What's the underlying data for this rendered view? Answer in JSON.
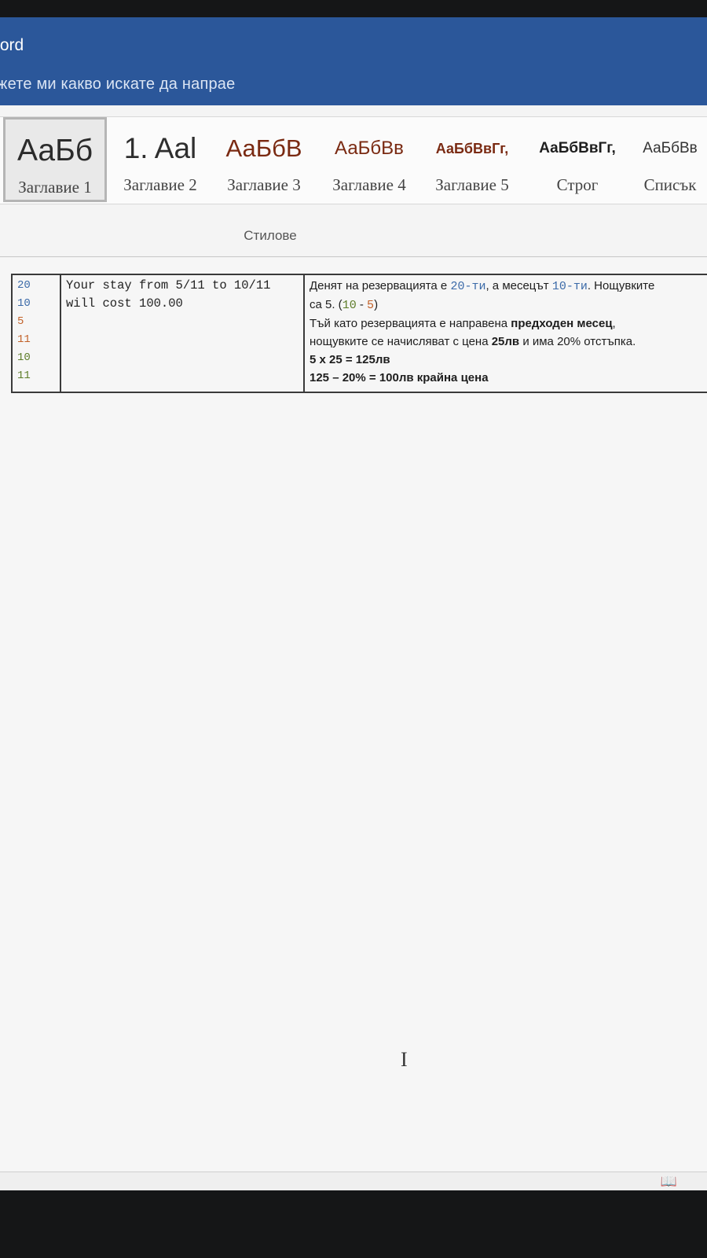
{
  "title_bar": {
    "app_name": "/ord",
    "tell_me": "жете ми какво искате да напрае"
  },
  "ribbon": {
    "styles": [
      {
        "sample": "АаБб",
        "name": "Заглавие 1",
        "selected": true
      },
      {
        "sample": "1. Aal",
        "name": "Заглавие 2"
      },
      {
        "sample": "АаБбВ",
        "name": "Заглавие 3"
      },
      {
        "sample": "АаБбВв",
        "name": "Заглавие 4"
      },
      {
        "sample": "АаБбВвГг,",
        "name": "Заглавие 5"
      },
      {
        "sample": "АаБбВвГг,",
        "name": "Строг"
      },
      {
        "sample": "АаБбВв",
        "name": "Списък"
      }
    ],
    "group_label": "Стилове"
  },
  "document": {
    "input_lines": [
      "20",
      "10",
      "5",
      "11",
      "10",
      "11"
    ],
    "output_text": "Your stay from 5/11 to 10/11 will cost 100.00",
    "note": {
      "l1_a": "Денят на резервацията е ",
      "l1_day": "20-ти",
      "l1_b": ", а месецът ",
      "l1_month": "10-ти",
      "l1_c": ". Нощувките",
      "l2_a": "са 5. (",
      "l2_x": "10",
      "l2_minus": " - ",
      "l2_y": "5",
      "l2_end": ")",
      "l3_a": "Тъй като резервацията е направена ",
      "l3_bold": "предходен месец",
      "l3_end": ",",
      "l4_a": "нощувките се начисляват с цена ",
      "l4_price": "25лв",
      "l4_b": " и има 20% отстъпка.",
      "l5": "5 x 25 = 125лв",
      "l6": "125 – 20% = 100лв крайна цена"
    }
  },
  "status_bar": {
    "icon": "read-mode-icon"
  }
}
